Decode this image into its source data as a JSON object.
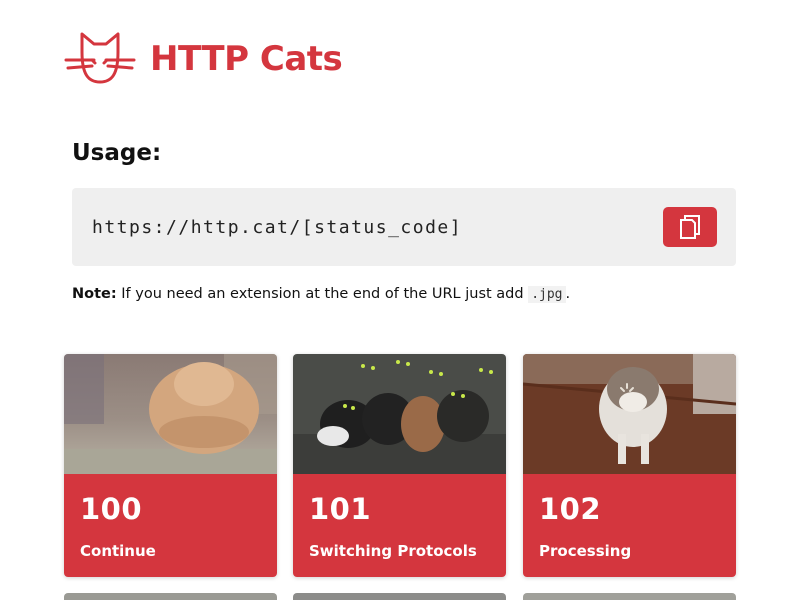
{
  "header": {
    "title": "HTTP Cats",
    "logo_icon": "cat-face-icon"
  },
  "usage": {
    "title": "Usage:",
    "code": "https://http.cat/[status_code]",
    "copy_icon": "copy-icon"
  },
  "note": {
    "label": "Note:",
    "text": " If you need an extension at the end of the URL just add ",
    "ext": ".jpg",
    "end": "."
  },
  "cards": [
    {
      "code": "100",
      "label": "Continue"
    },
    {
      "code": "101",
      "label": "Switching Protocols"
    },
    {
      "code": "102",
      "label": "Processing"
    }
  ],
  "colors": {
    "accent": "#d4363e",
    "code_bg": "#efefef"
  }
}
